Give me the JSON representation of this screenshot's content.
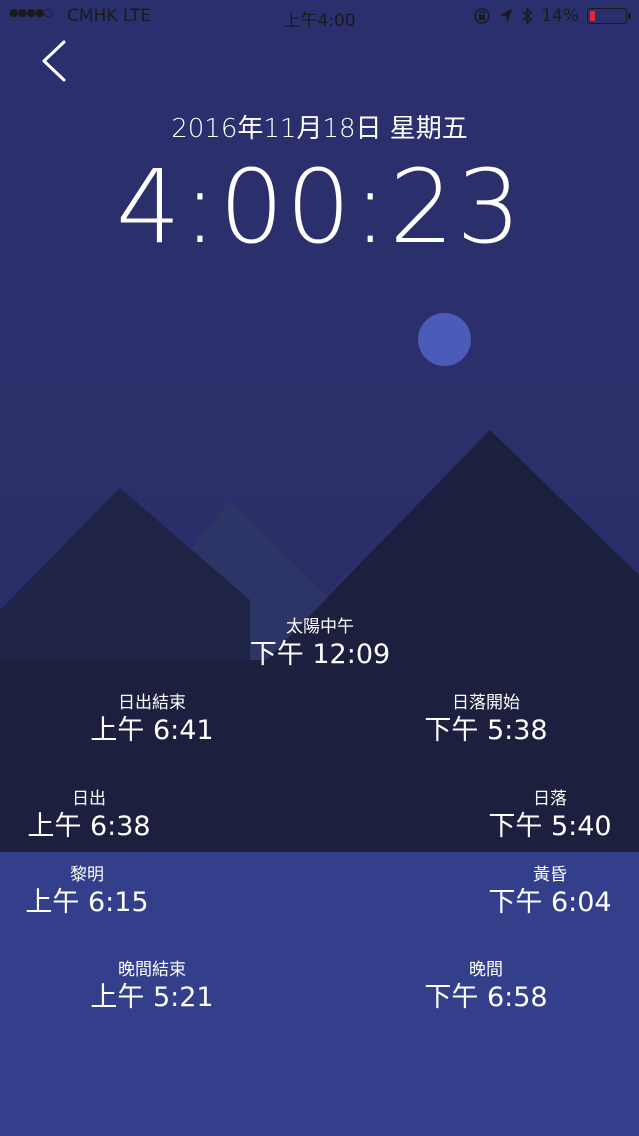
{
  "status_bar": {
    "signal": "●●●●○",
    "carrier": "CMHK   LTE",
    "time": "上午4:00",
    "battery": "14%",
    "battery_level": 0.14
  },
  "header": {
    "date": "2016年11月18日 星期五",
    "time": "4:00:23"
  },
  "events": {
    "solar_noon": {
      "label": "太陽中午",
      "value": "下午 12:09"
    },
    "sunrise_end": {
      "label": "日出結束",
      "value": "上午 6:41"
    },
    "sunset_start": {
      "label": "日落開始",
      "value": "下午 5:38"
    },
    "sunrise": {
      "label": "日出",
      "value": "上午 6:38"
    },
    "sunset": {
      "label": "日落",
      "value": "下午 5:40"
    },
    "dawn": {
      "label": "黎明",
      "value": "上午 6:15"
    },
    "dusk": {
      "label": "黃昏",
      "value": "下午 6:04"
    },
    "night_end": {
      "label": "晚間結束",
      "value": "上午 5:21"
    },
    "night": {
      "label": "晚間",
      "value": "下午 6:58"
    }
  },
  "colors": {
    "sky": "#2b2f6e",
    "mountain_back": "#2d3566",
    "mountain_front": "#1c1f3d",
    "moon": "#4b5cb8",
    "bottom_panel": "#343f8c"
  }
}
